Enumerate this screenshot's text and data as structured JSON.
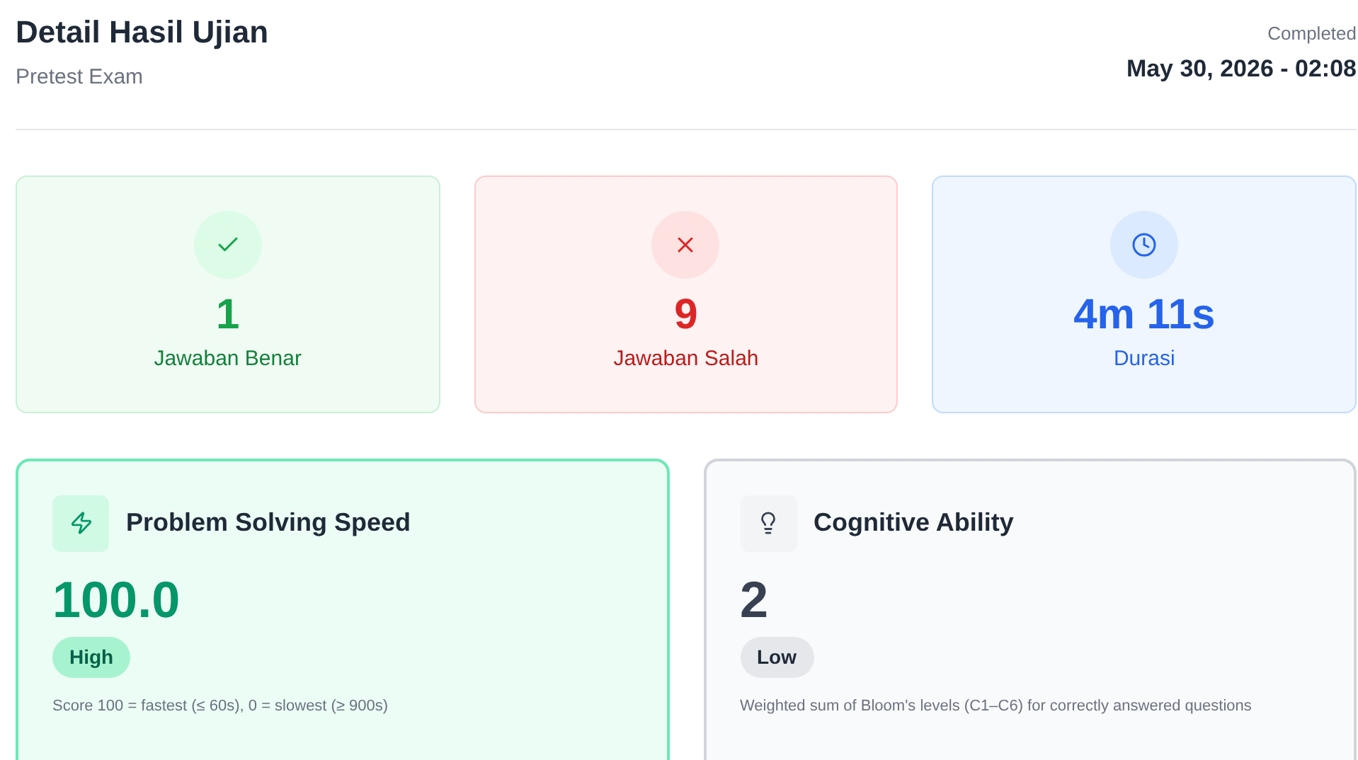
{
  "header": {
    "title": "Detail Hasil Ujian",
    "subtitle": "Pretest Exam",
    "status": "Completed",
    "date": "May 30, 2026 - 02:08"
  },
  "stats": [
    {
      "kind": "correct",
      "value": "1",
      "label": "Jawaban Benar"
    },
    {
      "kind": "wrong",
      "value": "9",
      "label": "Jawaban Salah"
    },
    {
      "kind": "duration",
      "value": "4m 11s",
      "label": "Durasi"
    }
  ],
  "metrics": [
    {
      "kind": "speed",
      "title": "Problem Solving Speed",
      "value": "100.0",
      "badge": "High",
      "note": "Score 100 = fastest (≤ 60s), 0 = slowest (≥ 900s)"
    },
    {
      "kind": "cognitive",
      "title": "Cognitive Ability",
      "value": "2",
      "badge": "Low",
      "note": "Weighted sum of Bloom's levels (C1–C6) for correctly answered questions"
    }
  ]
}
